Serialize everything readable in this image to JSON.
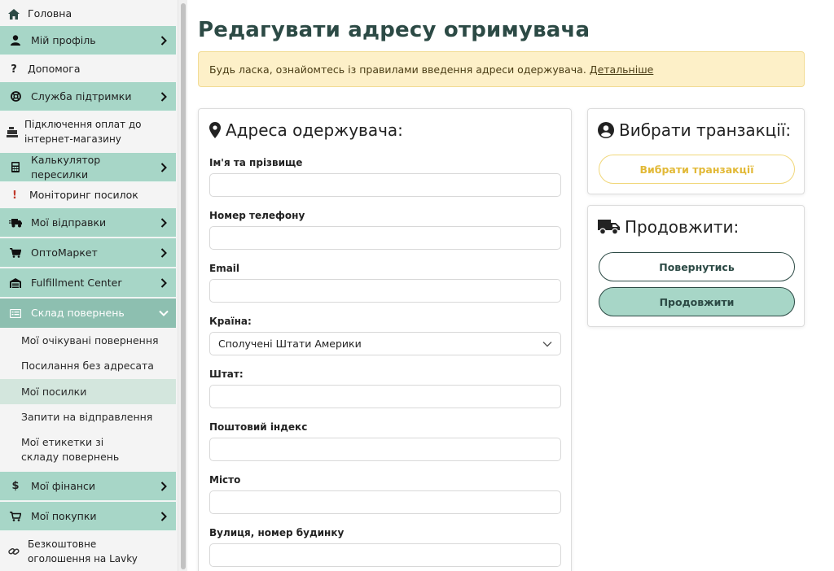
{
  "sidebar": {
    "items": [
      {
        "label": "Головна",
        "icon": "home-icon"
      },
      {
        "label": "Мій профіль",
        "icon": "user-icon"
      },
      {
        "label": "Допомога",
        "icon": "question-icon"
      },
      {
        "label": "Служба підтримки",
        "icon": "support-icon"
      },
      {
        "label": "Підключення оплат до інтернет-магазину",
        "icon": "cash-register-icon"
      },
      {
        "label": "Калькулятор пересилки",
        "icon": "calculator-icon"
      },
      {
        "label": "Моніторинг посилок",
        "icon": "exclamation-icon"
      },
      {
        "label": "Мої відправки",
        "icon": "truck-fast-icon"
      },
      {
        "label": "ОптоМаркет",
        "icon": "cart-icon"
      },
      {
        "label": "Fulfillment Center",
        "icon": "warehouse-icon"
      },
      {
        "label": "Склад повернень",
        "icon": "list-icon"
      },
      {
        "label": "Мої фінанси",
        "icon": "dollar-icon"
      },
      {
        "label": "Мої покупки",
        "icon": "cart-icon"
      },
      {
        "label": "Безкоштовне оголошення на Lavky",
        "icon": "link-icon"
      }
    ],
    "subitems": [
      {
        "label": "Мої очікувані повернення"
      },
      {
        "label": "Посилання без адресата"
      },
      {
        "label": "Мої посилки"
      },
      {
        "label": "Запити на відправлення"
      },
      {
        "label": "Мої етикетки зі складу повернень"
      }
    ]
  },
  "page": {
    "title": "Редагувати адресу отримувача",
    "alert_text": "Будь ласка, ознайомтесь із правилами введення адреси одержувача.",
    "alert_link": "Детальніше"
  },
  "address_card": {
    "title": "Адреса одержувача:",
    "fields": [
      {
        "label": "Ім'я та прізвище",
        "value": ""
      },
      {
        "label": "Номер телефону",
        "value": ""
      },
      {
        "label": "Email",
        "value": ""
      },
      {
        "label": "Країна:",
        "value": "Сполучені Штати Америки"
      },
      {
        "label": "Штат:",
        "value": ""
      },
      {
        "label": "Поштовий індекс",
        "value": ""
      },
      {
        "label": "Місто",
        "value": ""
      },
      {
        "label": "Вулиця, номер будинку",
        "value": ""
      }
    ]
  },
  "transactions_card": {
    "title": "Вибрати транзакції:",
    "button": "Вибрати транзакції"
  },
  "continue_card": {
    "title": "Продовжити:",
    "back_button": "Повернутись",
    "continue_button": "Продовжити"
  },
  "colors": {
    "accent_green": "#a7d6c7",
    "dark_green": "#2c4a45",
    "alert_bg": "#fdf0c8",
    "yellow": "#e2b937"
  }
}
